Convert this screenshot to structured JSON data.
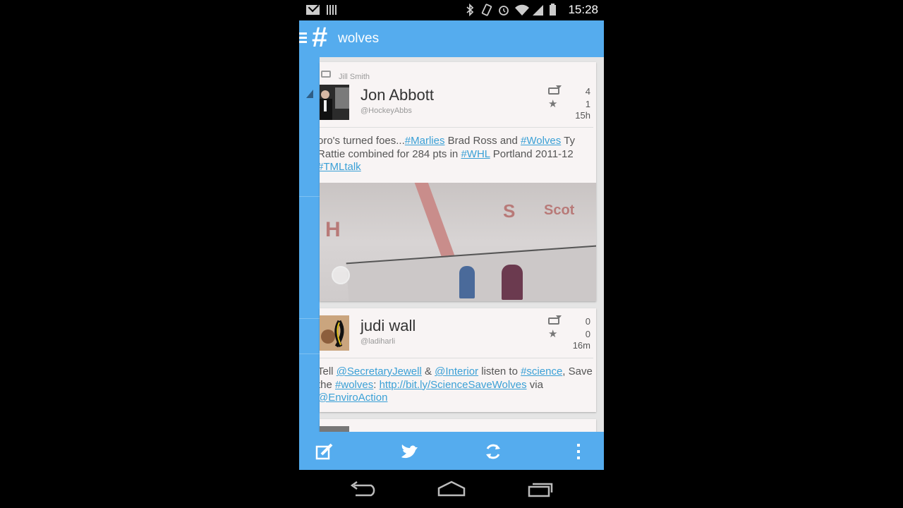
{
  "status_bar": {
    "time": "15:28",
    "icons": [
      "mail-icon",
      "signal-bars-icon",
      "bluetooth-icon",
      "vibrate-icon",
      "alarm-icon",
      "wifi-icon",
      "battery-icon"
    ]
  },
  "app_bar": {
    "icon": "hashtag-icon",
    "title": "wolves"
  },
  "tweets": [
    {
      "retweeted_by": "Jill Smith",
      "name": "Jon Abbott",
      "handle": "@HockeyAbbs",
      "retweets": "4",
      "favorites": "1",
      "age": "15h",
      "text_parts": [
        {
          "t": "oro's turned foes...",
          "link": false
        },
        {
          "t": "#Marlies",
          "link": true
        },
        {
          "t": " Brad Ross and ",
          "link": false
        },
        {
          "t": "#Wolves",
          "link": true
        },
        {
          "t": " Ty Rattie combined for 284 pts in ",
          "link": false
        },
        {
          "t": "#WHL",
          "link": true
        },
        {
          "t": " Portland 2011-12 ",
          "link": false
        },
        {
          "t": "#TMLtalk",
          "link": true
        }
      ],
      "has_photo": true
    },
    {
      "retweeted_by": "",
      "name": "judi wall",
      "handle": "@ladiharli",
      "retweets": "0",
      "favorites": "0",
      "age": "16m",
      "text_parts": [
        {
          "t": "Tell ",
          "link": false
        },
        {
          "t": "@SecretaryJewell",
          "link": true
        },
        {
          "t": " & ",
          "link": false
        },
        {
          "t": "@Interior",
          "link": true
        },
        {
          "t": " listen to ",
          "link": false
        },
        {
          "t": "#science",
          "link": true
        },
        {
          "t": ", Save the ",
          "link": false
        },
        {
          "t": "#wolves",
          "link": true
        },
        {
          "t": ": ",
          "link": false
        },
        {
          "t": "http://bit.ly/ScienceSaveWolves",
          "link": true
        },
        {
          "t": " via ",
          "link": false
        },
        {
          "t": "@EnviroAction",
          "link": true
        }
      ],
      "has_photo": false
    }
  ],
  "bottom_bar": [
    "compose-icon",
    "twitter-bird-icon",
    "refresh-icon",
    "overflow-menu-icon"
  ],
  "nav_bar": [
    "back-icon",
    "home-icon",
    "recents-icon"
  ],
  "colors": {
    "accent": "#55acee",
    "link": "#3aa0d6",
    "card_bg": "#f8f4f4"
  }
}
